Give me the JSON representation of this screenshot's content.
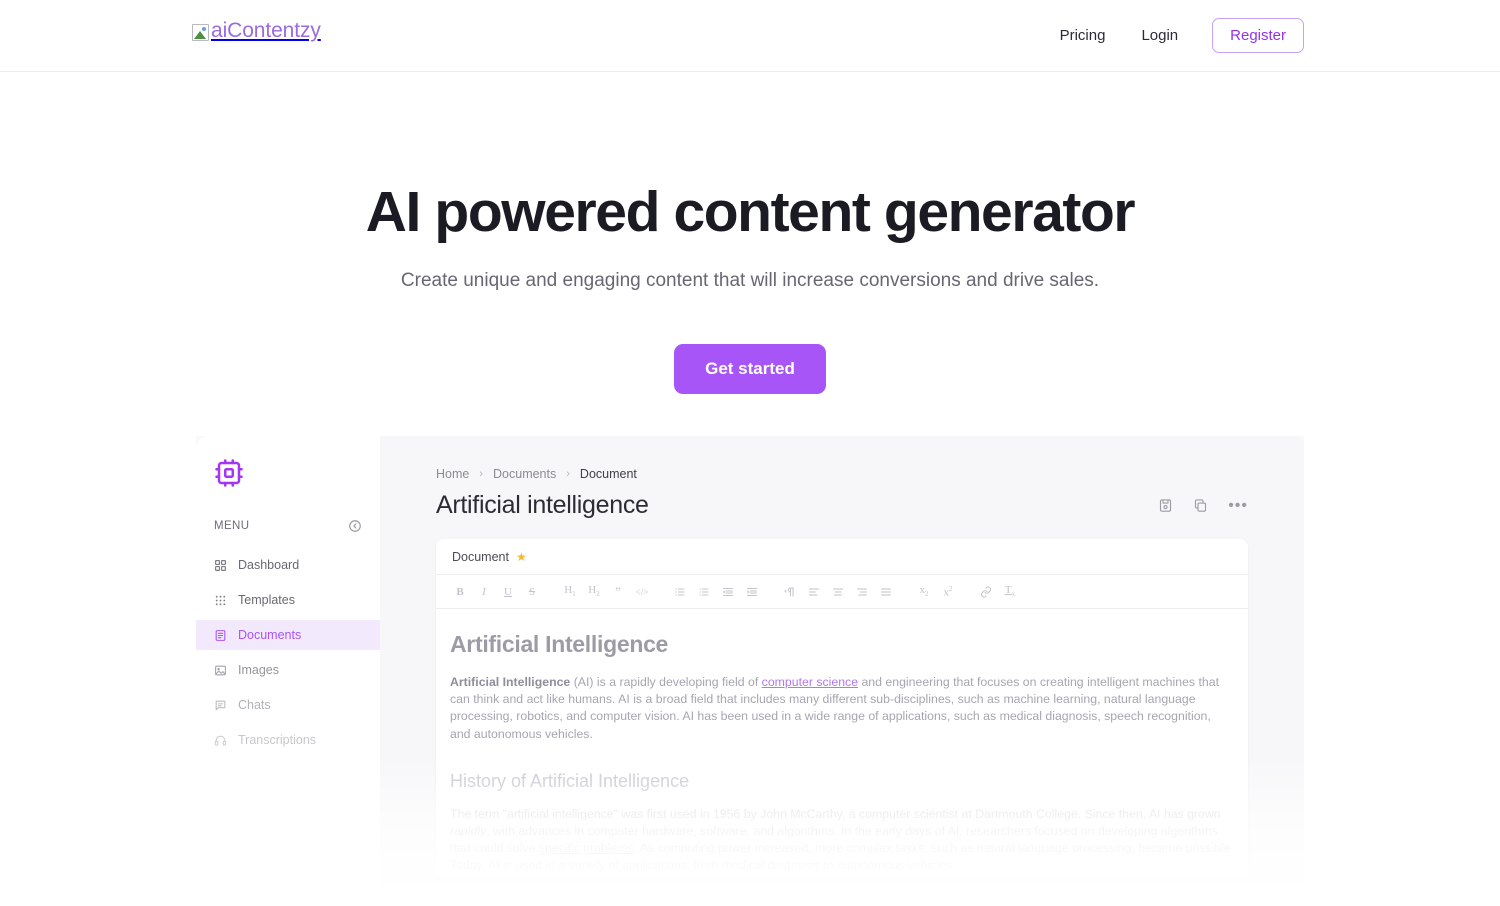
{
  "navbar": {
    "logo_alt": "aiContentzy",
    "logo_icon": "broken-image-icon",
    "links": [
      {
        "label": "Pricing",
        "name": "nav-link-pricing"
      },
      {
        "label": "Login",
        "name": "nav-link-login"
      }
    ],
    "register_label": "Register",
    "accent_color": "#9333ea"
  },
  "hero": {
    "heading": "AI powered content generator",
    "subheading": "Create unique and engaging content that will increase conversions and drive sales.",
    "cta_label": "Get started",
    "cta_color": "#a855f7"
  },
  "app_preview": {
    "sidebar": {
      "logo_icon": "cpu-chip-icon",
      "menu_label": "MENU",
      "collapse_icon": "collapse-circle-icon",
      "items": [
        {
          "label": "Dashboard",
          "icon": "grid-squares-icon",
          "active": false
        },
        {
          "label": "Templates",
          "icon": "dots-grid-icon",
          "active": false
        },
        {
          "label": "Documents",
          "icon": "document-lines-icon",
          "active": true
        },
        {
          "label": "Images",
          "icon": "image-icon",
          "active": false
        },
        {
          "label": "Chats",
          "icon": "chat-bubble-icon",
          "active": false
        },
        {
          "label": "Transcriptions",
          "icon": "headphones-icon",
          "active": false
        }
      ],
      "active_color": "#a855f7",
      "active_bg": "#f3e9fd"
    },
    "breadcrumb": [
      "Home",
      "Documents",
      "Document"
    ],
    "breadcrumb_separator": "›",
    "doc_title": "Artificial intelligence",
    "title_actions": [
      {
        "name": "save-document-icon",
        "icon": "save-disk-icon"
      },
      {
        "name": "copy-document-icon",
        "icon": "copy-icon"
      },
      {
        "name": "more-options-button",
        "icon": "ellipsis-icon",
        "glyph": "•••"
      }
    ],
    "editor": {
      "tab_label": "Document",
      "tab_star_icon": "star-icon",
      "toolbar": [
        {
          "name": "bold-button",
          "label": "B"
        },
        {
          "name": "italic-button",
          "label": "I"
        },
        {
          "name": "underline-button",
          "label": "U"
        },
        {
          "name": "strikethrough-button",
          "label": "S"
        },
        {
          "name": "heading-1-button",
          "label": "H1"
        },
        {
          "name": "heading-2-button",
          "label": "H2"
        },
        {
          "name": "blockquote-button",
          "label": "”"
        },
        {
          "name": "code-block-button",
          "label": "</>"
        },
        {
          "name": "ordered-list-button",
          "label": "ol"
        },
        {
          "name": "bullet-list-button",
          "label": "ul"
        },
        {
          "name": "outdent-button",
          "label": "outdent"
        },
        {
          "name": "indent-button",
          "label": "indent"
        },
        {
          "name": "text-direction-button",
          "label": "rtl"
        },
        {
          "name": "align-left-button",
          "label": "left"
        },
        {
          "name": "align-center-button",
          "label": "center"
        },
        {
          "name": "align-right-button",
          "label": "right"
        },
        {
          "name": "align-justify-button",
          "label": "justify"
        },
        {
          "name": "subscript-button",
          "label": "x2"
        },
        {
          "name": "superscript-button",
          "label": "x2"
        },
        {
          "name": "link-button",
          "label": "link"
        },
        {
          "name": "clear-format-button",
          "label": "Tx"
        }
      ],
      "content": {
        "h1": "Artificial Intelligence",
        "p1_bold": "Artificial Intelligence",
        "p1_before_link": " (AI) is a rapidly developing field of ",
        "p1_link": "computer science",
        "p1_after_link": " and engineering that focuses on creating intelligent machines that can think and act like humans. AI is a broad field that includes many different sub-disciplines, such as machine learning, natural language processing, robotics, and computer vision. AI has been used in a wide range of applications, such as medical diagnosis, speech recognition, and autonomous vehicles.",
        "h2": "History of Artificial Intelligence",
        "p2_a": "The term \"artificial intelligence\" was first used in 1956 by John McCarthy, a computer scientist at Dartmouth College. Since then, AI has grown ",
        "p2_italic": "rapidly",
        "p2_b": ", with advances in computer hardware, software, and algorithms. In the early days of AI, researchers focused on developing algorithms that could solve ",
        "p2_underline": "specific problems",
        "p2_c": ". As computing power increased, more complex tasks, such as natural language processing, became possible. Today, AI is used in a variety of applications, from medical diagnosis to autonomous vehicles."
      }
    }
  }
}
